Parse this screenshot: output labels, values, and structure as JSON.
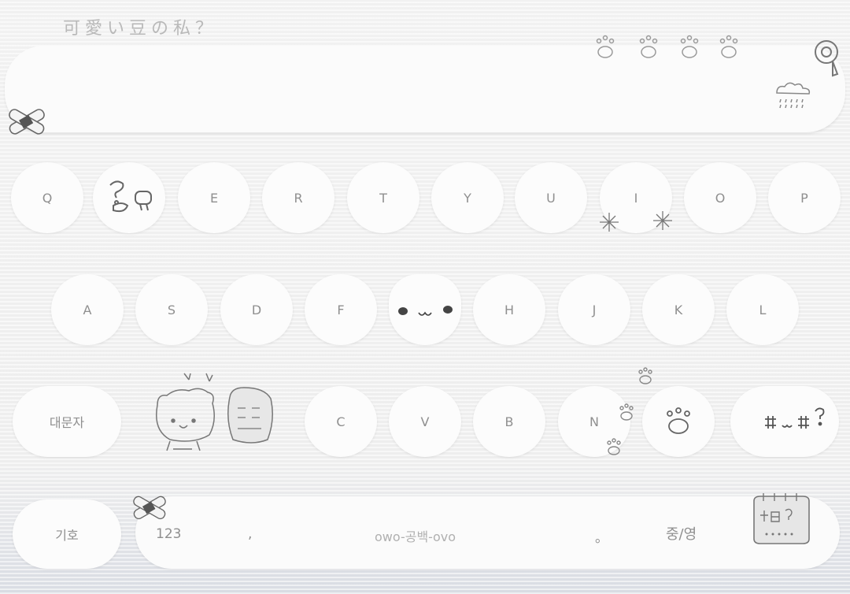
{
  "title": "可愛い豆の私？",
  "row1": [
    "Q",
    "",
    "E",
    "R",
    "T",
    "Y",
    "U",
    "I",
    "O",
    "P"
  ],
  "row2": [
    "A",
    "S",
    "D",
    "F",
    "",
    "H",
    "J",
    "K",
    "L"
  ],
  "row3": {
    "shift": "대문자",
    "c": "C",
    "v": "V",
    "b": "B",
    "n": "N"
  },
  "bottom": {
    "symbols": "기호",
    "numbers": "123",
    "comma": ",",
    "space": "owo-공백-ovo",
    "period": "。",
    "lang": "중/영"
  }
}
